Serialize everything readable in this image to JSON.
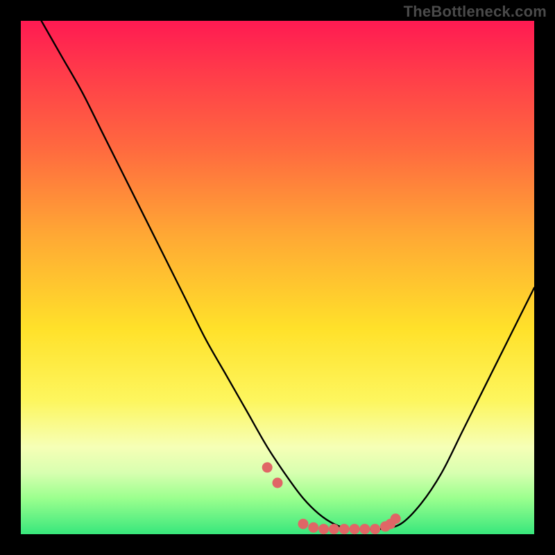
{
  "watermark": "TheBottleneck.com",
  "chart_data": {
    "type": "line",
    "title": "",
    "xlabel": "",
    "ylabel": "",
    "xlim": [
      0,
      100
    ],
    "ylim": [
      0,
      100
    ],
    "series": [
      {
        "name": "bottleneck-curve",
        "x": [
          4,
          8,
          12,
          16,
          20,
          24,
          28,
          32,
          36,
          40,
          44,
          48,
          52,
          55,
          58,
          61,
          64,
          67,
          70,
          74,
          78,
          82,
          86,
          90,
          94,
          98,
          100
        ],
        "y": [
          100,
          93,
          86,
          78,
          70,
          62,
          54,
          46,
          38,
          31,
          24,
          17,
          11,
          7,
          4,
          2,
          1,
          1,
          1,
          2,
          6,
          12,
          20,
          28,
          36,
          44,
          48
        ]
      }
    ],
    "markers": {
      "name": "highlight-points",
      "color": "#e06666",
      "x": [
        48,
        50,
        55,
        57,
        59,
        61,
        63,
        65,
        67,
        69,
        71,
        72,
        73
      ],
      "y": [
        13,
        10,
        2,
        1.3,
        1,
        1,
        1,
        1,
        1,
        1,
        1.5,
        2,
        3
      ]
    }
  }
}
